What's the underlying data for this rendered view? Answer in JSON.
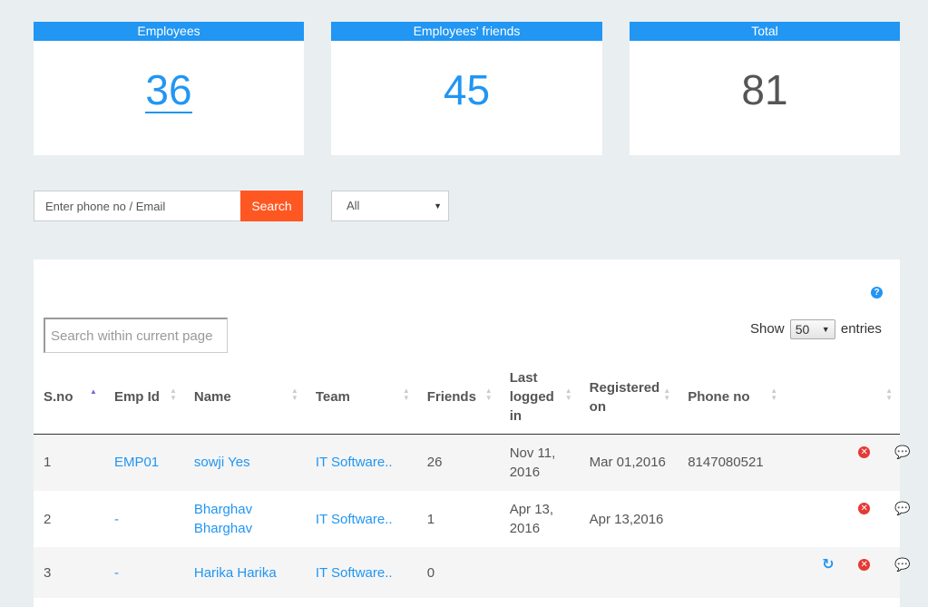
{
  "stats": [
    {
      "label": "Employees",
      "value": "36"
    },
    {
      "label": "Employees' friends",
      "value": "45"
    },
    {
      "label": "Total",
      "value": "81"
    }
  ],
  "search": {
    "placeholder": "Enter phone no / Email",
    "button": "Search"
  },
  "filter": {
    "selected": "All"
  },
  "table_panel": {
    "page_search_placeholder": "Search within current page",
    "show_label": "Show",
    "entries_value": "50",
    "entries_label": "entries"
  },
  "columns": [
    "S.no",
    "Emp Id",
    "Name",
    "Team",
    "Friends",
    "Last logged in",
    "Registered on",
    "Phone no"
  ],
  "rows": [
    {
      "sno": "1",
      "emp_id": "EMP01",
      "name": "sowji Yes",
      "team": "IT Software..",
      "friends": "26",
      "last_logged": "Nov 11, 2016",
      "registered": "Mar 01,2016",
      "phone": "8147080521"
    },
    {
      "sno": "2",
      "emp_id": "-",
      "name": "Bharghav Bharghav",
      "team": "IT Software..",
      "friends": "1",
      "last_logged": "Apr 13, 2016",
      "registered": "Apr 13,2016",
      "phone": ""
    },
    {
      "sno": "3",
      "emp_id": "-",
      "name": "Harika Harika",
      "team": "IT Software..",
      "friends": "0",
      "last_logged": "",
      "registered": "",
      "phone": ""
    }
  ],
  "icons": {
    "help": "question-circle-icon",
    "remove": "remove-circle-icon",
    "chat": "chat-bubbles-icon",
    "refresh": "refresh-icon"
  },
  "colors": {
    "accent": "#2196f3",
    "search_button": "#ff5722",
    "danger": "#e53935"
  }
}
